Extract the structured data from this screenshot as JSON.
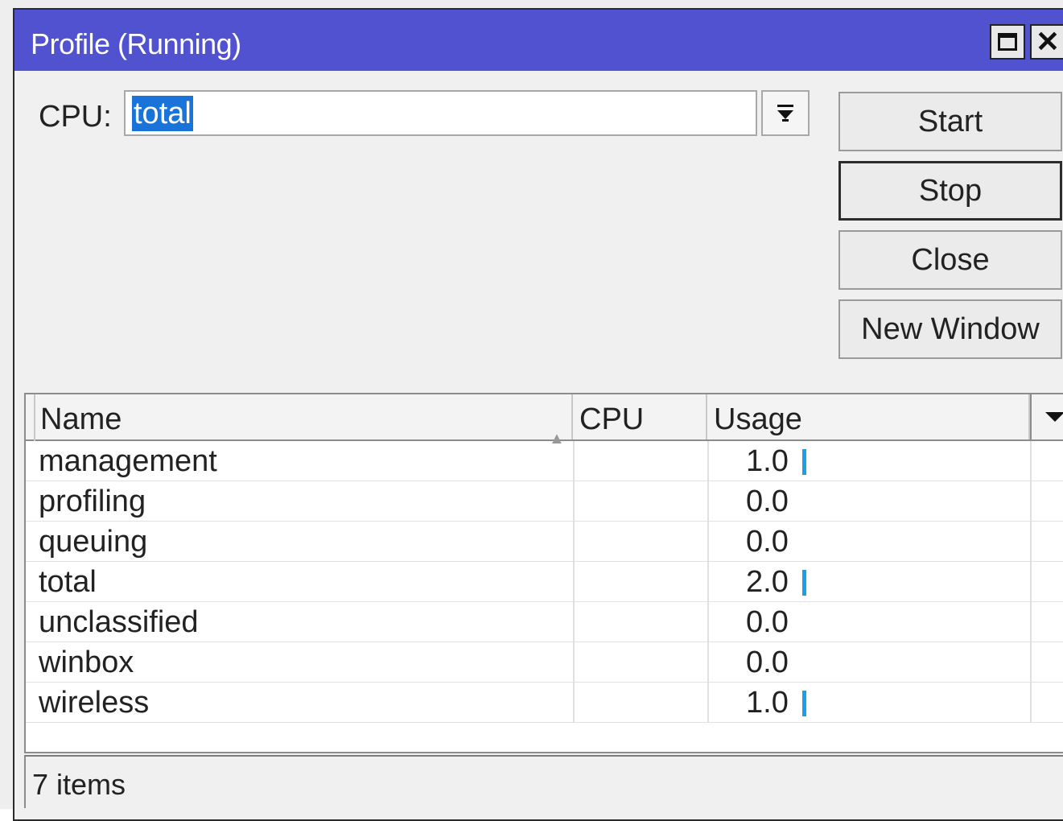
{
  "window": {
    "title": "Profile (Running)",
    "maximize_icon": "maximize-icon",
    "close_icon": "close-icon",
    "close_glyph": "✕"
  },
  "cpu_selector": {
    "label": "CPU:",
    "value": "total",
    "dropdown_icon": "dropdown-arrow-icon"
  },
  "buttons": {
    "start": "Start",
    "stop": "Stop",
    "close": "Close",
    "new_window": "New Window"
  },
  "table": {
    "columns": [
      "Name",
      "CPU",
      "Usage"
    ],
    "sort_icon": "sort-ascending-icon",
    "column_menu_icon": "column-menu-icon",
    "rows": [
      {
        "name": "management",
        "cpu": "",
        "usage": "1.0",
        "bar": true
      },
      {
        "name": "profiling",
        "cpu": "",
        "usage": "0.0",
        "bar": false
      },
      {
        "name": "queuing",
        "cpu": "",
        "usage": "0.0",
        "bar": false
      },
      {
        "name": "total",
        "cpu": "",
        "usage": "2.0",
        "bar": true
      },
      {
        "name": "unclassified",
        "cpu": "",
        "usage": "0.0",
        "bar": false
      },
      {
        "name": "winbox",
        "cpu": "",
        "usage": "0.0",
        "bar": false
      },
      {
        "name": "wireless",
        "cpu": "",
        "usage": "1.0",
        "bar": true
      }
    ]
  },
  "status": {
    "items_count": "7 items"
  },
  "colors": {
    "titlebar": "#5052cf",
    "selection": "#1a73d9",
    "usage_bar": "#1aa0e8"
  }
}
